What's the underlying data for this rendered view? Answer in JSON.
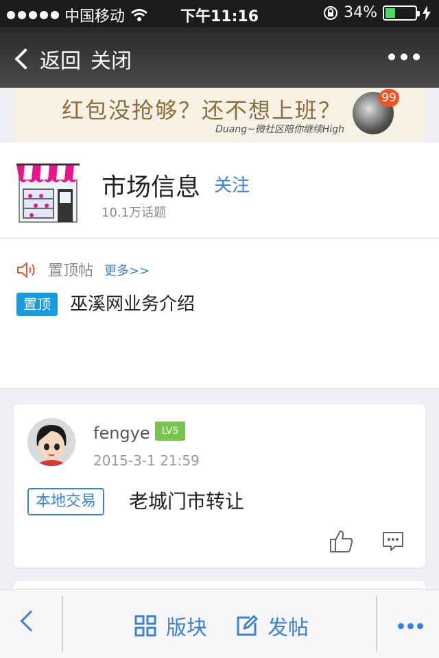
{
  "status_bar": {
    "carrier": "中国移动",
    "time": "下午11:16",
    "battery_percent": "34%",
    "battery_level": 0.34
  },
  "nav": {
    "back_label": "返回",
    "close_label": "关闭"
  },
  "banner": {
    "headline": "红包没抢够？还不想上班？",
    "subline": "Duang~微社区陪你继续High",
    "badge": "99"
  },
  "forum": {
    "title": "市场信息",
    "follow_label": "关注",
    "topic_count": "10.1万话题"
  },
  "pinned": {
    "section_label": "置顶帖",
    "more_label": "更多>>",
    "items": [
      {
        "tag": "置顶",
        "title": "巫溪网业务介绍"
      }
    ]
  },
  "posts": [
    {
      "username": "fengye",
      "level": "LV5",
      "time": "2015-3-1 21:59",
      "category": "本地交易",
      "title": "老城门市转让"
    }
  ],
  "bottom_bar": {
    "section_label": "版块",
    "post_label": "发帖"
  },
  "colors": {
    "accent": "#3b82d6",
    "pinned_tag": "#1a9be0",
    "level_badge": "#79c34f",
    "banner_badge": "#f05423"
  }
}
